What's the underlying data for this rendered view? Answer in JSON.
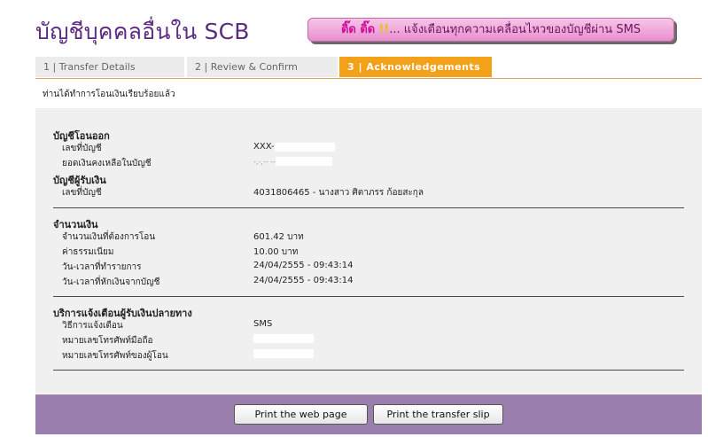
{
  "header": {
    "title": "บัญชีบุคคลอื่นใน SCB",
    "promo_prefix": "ติ๊ด ติ๊ด",
    "promo_bang": "!!",
    "promo_text": "... แจ้งเตือนทุกความเคลื่อนไหวของบัญชีผ่าน SMS"
  },
  "steps": [
    {
      "label": "1 | Transfer Details"
    },
    {
      "label": "2 | Review & Confirm"
    },
    {
      "label": "3 | Acknowledgements"
    }
  ],
  "success_message": "ท่านได้ทำการโอนเงินเรียบร้อยแล้ว",
  "from_account": {
    "title": "บัญชีโอนออก",
    "account_label": "เลขที่บัญชี",
    "account_value": "XXX-",
    "balance_label": "ยอดเงินคงเหลือในบัญชี",
    "balance_value": "-,-,-- --"
  },
  "to_account": {
    "title": "บัญชีผู้รับเงิน",
    "account_label": "เลขที่บัญชี",
    "account_value": "4031806465 - นางสาว ศิตาภรร ก้อยสะกุล"
  },
  "amount": {
    "title": "จำนวนเงิน",
    "rows": [
      {
        "label": "จำนวนเงินที่ต้องการโอน",
        "value": "601.42 บาท"
      },
      {
        "label": "ค่าธรรมเนียม",
        "value": "10.00 บาท"
      },
      {
        "label": "วัน-เวลาที่ทำรายการ",
        "value": "24/04/2555 - 09:43:14"
      },
      {
        "label": "วัน-เวลาที่หักเงินจากบัญชี",
        "value": "24/04/2555 - 09:43:14"
      }
    ]
  },
  "notify": {
    "title": "บริการแจ้งเตือนผู้รับเงินปลายทาง",
    "method_label": "วิธีการแจ้งเตือน",
    "method_value": "SMS",
    "mobile_label": "หมายเลขโทรศัพท์มือถือ",
    "sender_phone_label": "หมายเลขโทรศัพท์ของผู้โอน"
  },
  "buttons": {
    "print_page": "Print the web page",
    "print_slip": "Print the transfer slip"
  }
}
